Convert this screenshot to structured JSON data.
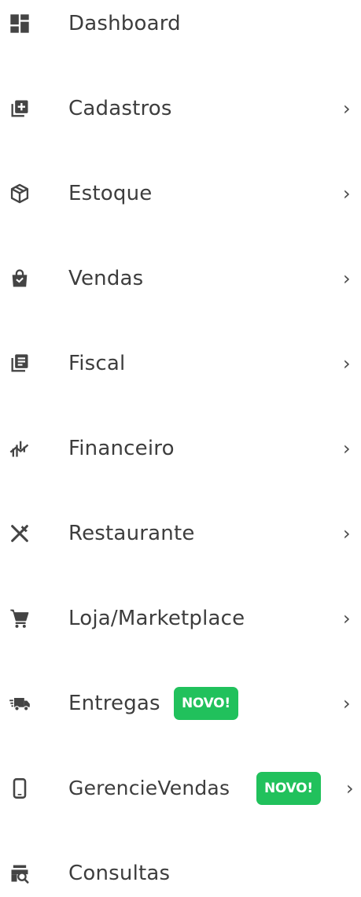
{
  "menu": {
    "items": [
      {
        "label": "Dashboard",
        "icon": "dashboard-icon",
        "has_submenu": false
      },
      {
        "label": "Cadastros",
        "icon": "add-box-icon",
        "has_submenu": true,
        "chevron": "›"
      },
      {
        "label": "Estoque",
        "icon": "package-box-icon",
        "has_submenu": true,
        "chevron": "›"
      },
      {
        "label": "Vendas",
        "icon": "shopping-bag-icon",
        "has_submenu": true,
        "chevron": "›"
      },
      {
        "label": "Fiscal",
        "icon": "document-stack-icon",
        "has_submenu": true,
        "chevron": "›"
      },
      {
        "label": "Financeiro",
        "icon": "chart-trend-icon",
        "has_submenu": true,
        "chevron": "›"
      },
      {
        "label": "Restaurante",
        "icon": "utensils-icon",
        "has_submenu": true,
        "chevron": "›"
      },
      {
        "label": "Loja/Marketplace",
        "icon": "shopping-cart-icon",
        "has_submenu": true,
        "chevron": "›"
      },
      {
        "label": "Entregas",
        "icon": "truck-icon",
        "has_submenu": true,
        "badge": "NOVO!",
        "chevron": "›"
      },
      {
        "label": "GerencieVendas",
        "icon": "smartphone-icon",
        "has_submenu": true,
        "badge": "NOVO!",
        "chevron": "›"
      },
      {
        "label": "Consultas",
        "icon": "search-card-icon",
        "has_submenu": false
      }
    ]
  },
  "colors": {
    "text": "#3d3d3d",
    "icon": "#444444",
    "badge_bg": "#21c15c",
    "badge_text": "#ffffff",
    "background": "#ffffff"
  }
}
